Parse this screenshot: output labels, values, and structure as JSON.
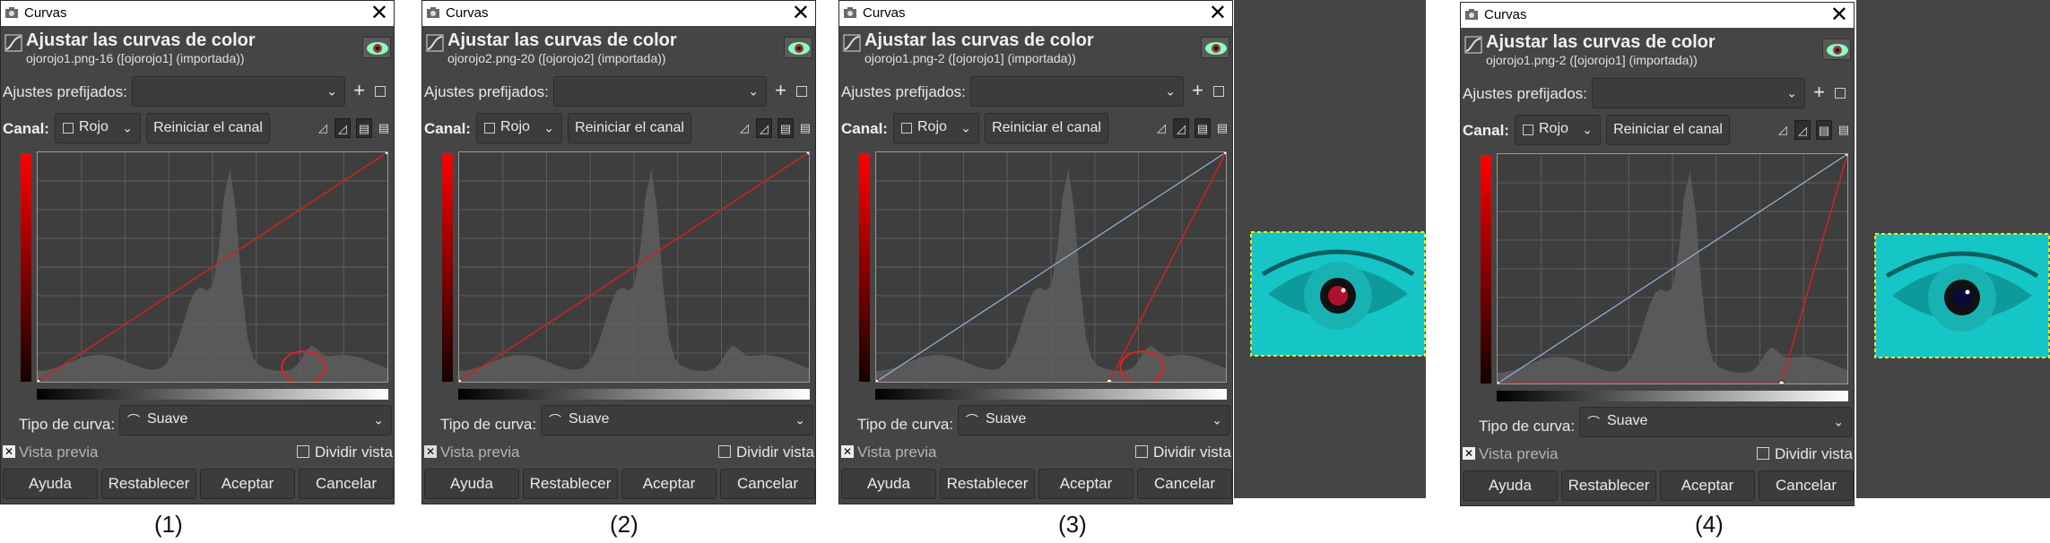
{
  "dialogs": [
    {
      "window_title": "Curvas",
      "title": "Ajustar las curvas de color",
      "subtitle": "ojorojo1.png-16 ([ojorojo1] (importada))",
      "presets_label": "Ajustes prefijados:",
      "channel_label": "Canal:",
      "channel_value": "Rojo",
      "reset_channel": "Reiniciar el canal",
      "curve_type_label": "Tipo de curva:",
      "curve_type_value": "Suave",
      "preview_label": "Vista previa",
      "split_view_label": "Dividir vista",
      "buttons": [
        "Ayuda",
        "Restablecer",
        "Aceptar",
        "Cancelar"
      ],
      "caption": "(1)",
      "curve_points": [
        [
          0,
          0
        ],
        [
          255,
          255
        ]
      ],
      "highlight": "right-peak"
    },
    {
      "window_title": "Curvas",
      "title": "Ajustar las curvas de color",
      "subtitle": "ojorojo2.png-20 ([ojorojo2] (importada))",
      "presets_label": "Ajustes prefijados:",
      "channel_label": "Canal:",
      "channel_value": "Rojo",
      "reset_channel": "Reiniciar el canal",
      "curve_type_label": "Tipo de curva:",
      "curve_type_value": "Suave",
      "preview_label": "Vista previa",
      "split_view_label": "Dividir vista",
      "buttons": [
        "Ayuda",
        "Restablecer",
        "Aceptar",
        "Cancelar"
      ],
      "caption": "(2)",
      "curve_points": [
        [
          0,
          0
        ],
        [
          255,
          255
        ]
      ],
      "highlight": "none"
    },
    {
      "window_title": "Curvas",
      "title": "Ajustar las curvas de color",
      "subtitle": "ojorojo1.png-2 ([ojorojo1] (importada))",
      "presets_label": "Ajustes prefijados:",
      "channel_label": "Canal:",
      "channel_value": "Rojo",
      "reset_channel": "Reiniciar el canal",
      "curve_type_label": "Tipo de curva:",
      "curve_type_value": "Suave",
      "preview_label": "Vista previa",
      "split_view_label": "Dividir vista",
      "buttons": [
        "Ayuda",
        "Restablecer",
        "Aceptar",
        "Cancelar"
      ],
      "caption": "(3)",
      "curve_points": [
        [
          0,
          0
        ],
        [
          170,
          0
        ],
        [
          255,
          255
        ]
      ],
      "highlight": "right-peak",
      "pupil_color": "#b01030"
    },
    {
      "window_title": "Curvas",
      "title": "Ajustar las curvas de color",
      "subtitle": "ojorojo1.png-2 ([ojorojo1] (importada))",
      "presets_label": "Ajustes prefijados:",
      "channel_label": "Canal:",
      "channel_value": "Rojo",
      "reset_channel": "Reiniciar el canal",
      "curve_type_label": "Tipo de curva:",
      "curve_type_value": "Suave",
      "preview_label": "Vista previa",
      "split_view_label": "Dividir vista",
      "buttons": [
        "Ayuda",
        "Restablecer",
        "Aceptar",
        "Cancelar"
      ],
      "caption": "(4)",
      "curve_points": [
        [
          0,
          0
        ],
        [
          207,
          0
        ],
        [
          255,
          255
        ]
      ],
      "highlight": "none",
      "pupil_color": "#0a0a3a"
    }
  ],
  "colors": {
    "curve": "#cc2222",
    "identity_line": "#8fb4d8",
    "histogram": "#5e5e5e",
    "highlight": "#e02020",
    "iris": "#19b2b2",
    "photo_bg": "#16c6c6",
    "photo_border": "#e8e820"
  },
  "icons": {
    "window": "camera-icon",
    "header": "curve-icon",
    "eye": "eye-icon",
    "close": "close-icon"
  }
}
